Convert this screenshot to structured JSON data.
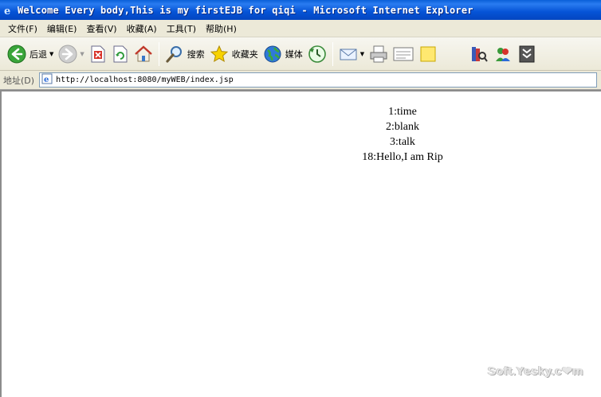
{
  "window": {
    "title": "Welcome Every body,This is my firstEJB for qiqi - Microsoft Internet Explorer"
  },
  "menubar": {
    "items": [
      "文件(F)",
      "编辑(E)",
      "查看(V)",
      "收藏(A)",
      "工具(T)",
      "帮助(H)"
    ]
  },
  "toolbar": {
    "back_label": "后退",
    "search_label": "搜索",
    "favorites_label": "收藏夹",
    "media_label": "媒体",
    "icons": [
      "back-arrow-icon",
      "forward-arrow-icon",
      "stop-icon",
      "refresh-icon",
      "home-icon",
      "search-magnifier-icon",
      "favorites-star-icon",
      "media-globe-icon",
      "history-icon",
      "mail-icon",
      "print-icon",
      "edit-icon",
      "discuss-icon",
      "research-icon",
      "messenger-icon",
      "extension-icon"
    ]
  },
  "addressbar": {
    "label": "地址(D)",
    "url": "http://localhost:8080/myWEB/index.jsp"
  },
  "page": {
    "lines": [
      "1:time",
      "2:blank",
      "3:talk",
      "18:Hello,I am Rip"
    ]
  },
  "watermark": "Soft.Yesky.c❤m",
  "colors": {
    "titlebar": "#0553d6",
    "chrome": "#ece9d8",
    "content_bg": "#ffffff"
  }
}
